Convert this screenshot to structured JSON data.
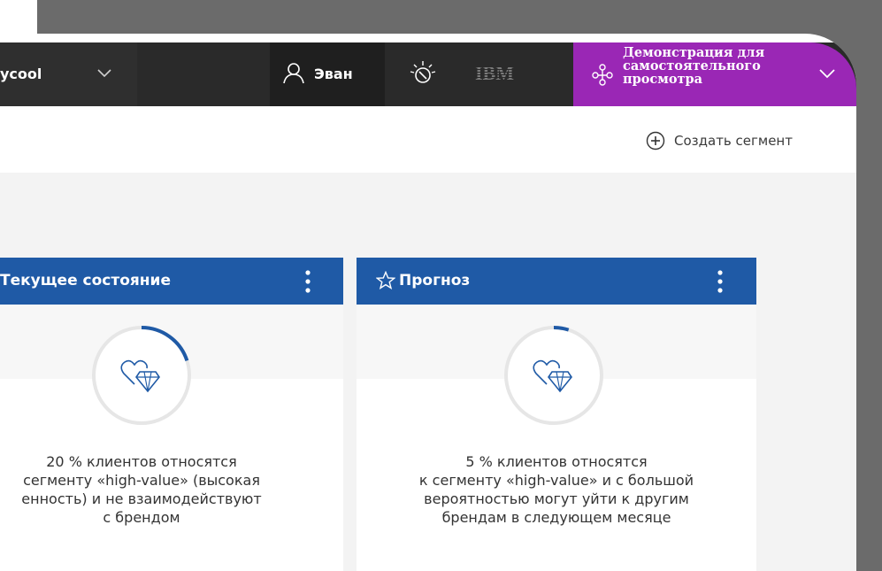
{
  "header": {
    "brand": "ycool",
    "user_name": "Эван",
    "ibm_logo": "IBM",
    "demo_lines": [
      "Демонстрация для",
      "самостоятельного",
      "просмотра"
    ]
  },
  "toolbar": {
    "create_segment_label": "Создать сегмент"
  },
  "cards": [
    {
      "title": "Текущее состояние",
      "progress_percent": 20,
      "text_lines": [
        "20 % клиентов относятся",
        "сегменту «high-value» (высокая",
        "енность) и не взаимодействуют",
        "с брендом"
      ]
    },
    {
      "title": "Прогноз",
      "progress_percent": 5,
      "text_lines": [
        "5 % клиентов относятся",
        "к сегменту «high-value» и с большой",
        "вероятностью могут уйти к другим",
        "брендам в следующем месяце"
      ]
    }
  ],
  "colors": {
    "nav_bg": "#2a2a2a",
    "demo_purple": "#9a27b5",
    "card_header_blue": "#1f5aa6",
    "gauge_arc": "#1f5aa6"
  },
  "icons": [
    "user-icon",
    "watson-icon",
    "ibm-logo",
    "demo-flow-icon",
    "chevron-down-icon",
    "plus-circle-icon",
    "star-icon",
    "kebab-icon",
    "heart-diamond-icon"
  ]
}
